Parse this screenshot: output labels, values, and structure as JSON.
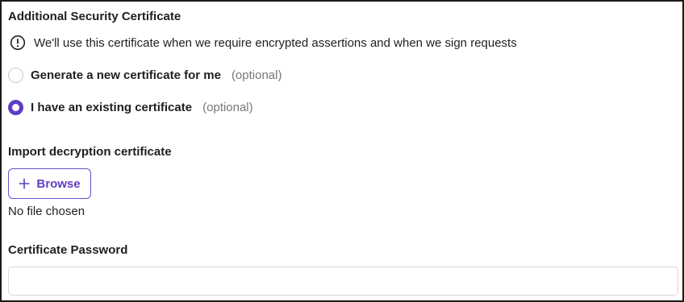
{
  "section": {
    "title": "Additional Security Certificate",
    "info_icon": "exclamation-circle-icon",
    "info_text": "We'll use this certificate when we require encrypted assertions and when we sign requests"
  },
  "options": [
    {
      "label": "Generate a new certificate for me",
      "optional": "(optional)",
      "selected": false
    },
    {
      "label": "I have an existing certificate",
      "optional": "(optional)",
      "selected": true
    }
  ],
  "import": {
    "label": "Import decryption certificate",
    "browse_icon": "plus-icon",
    "browse_label": "Browse",
    "file_status": "No file chosen"
  },
  "password": {
    "label": "Certificate Password",
    "value": "",
    "placeholder": ""
  },
  "colors": {
    "accent": "#5f3dc4",
    "border": "#d8d8dc",
    "muted_text": "#777777"
  }
}
